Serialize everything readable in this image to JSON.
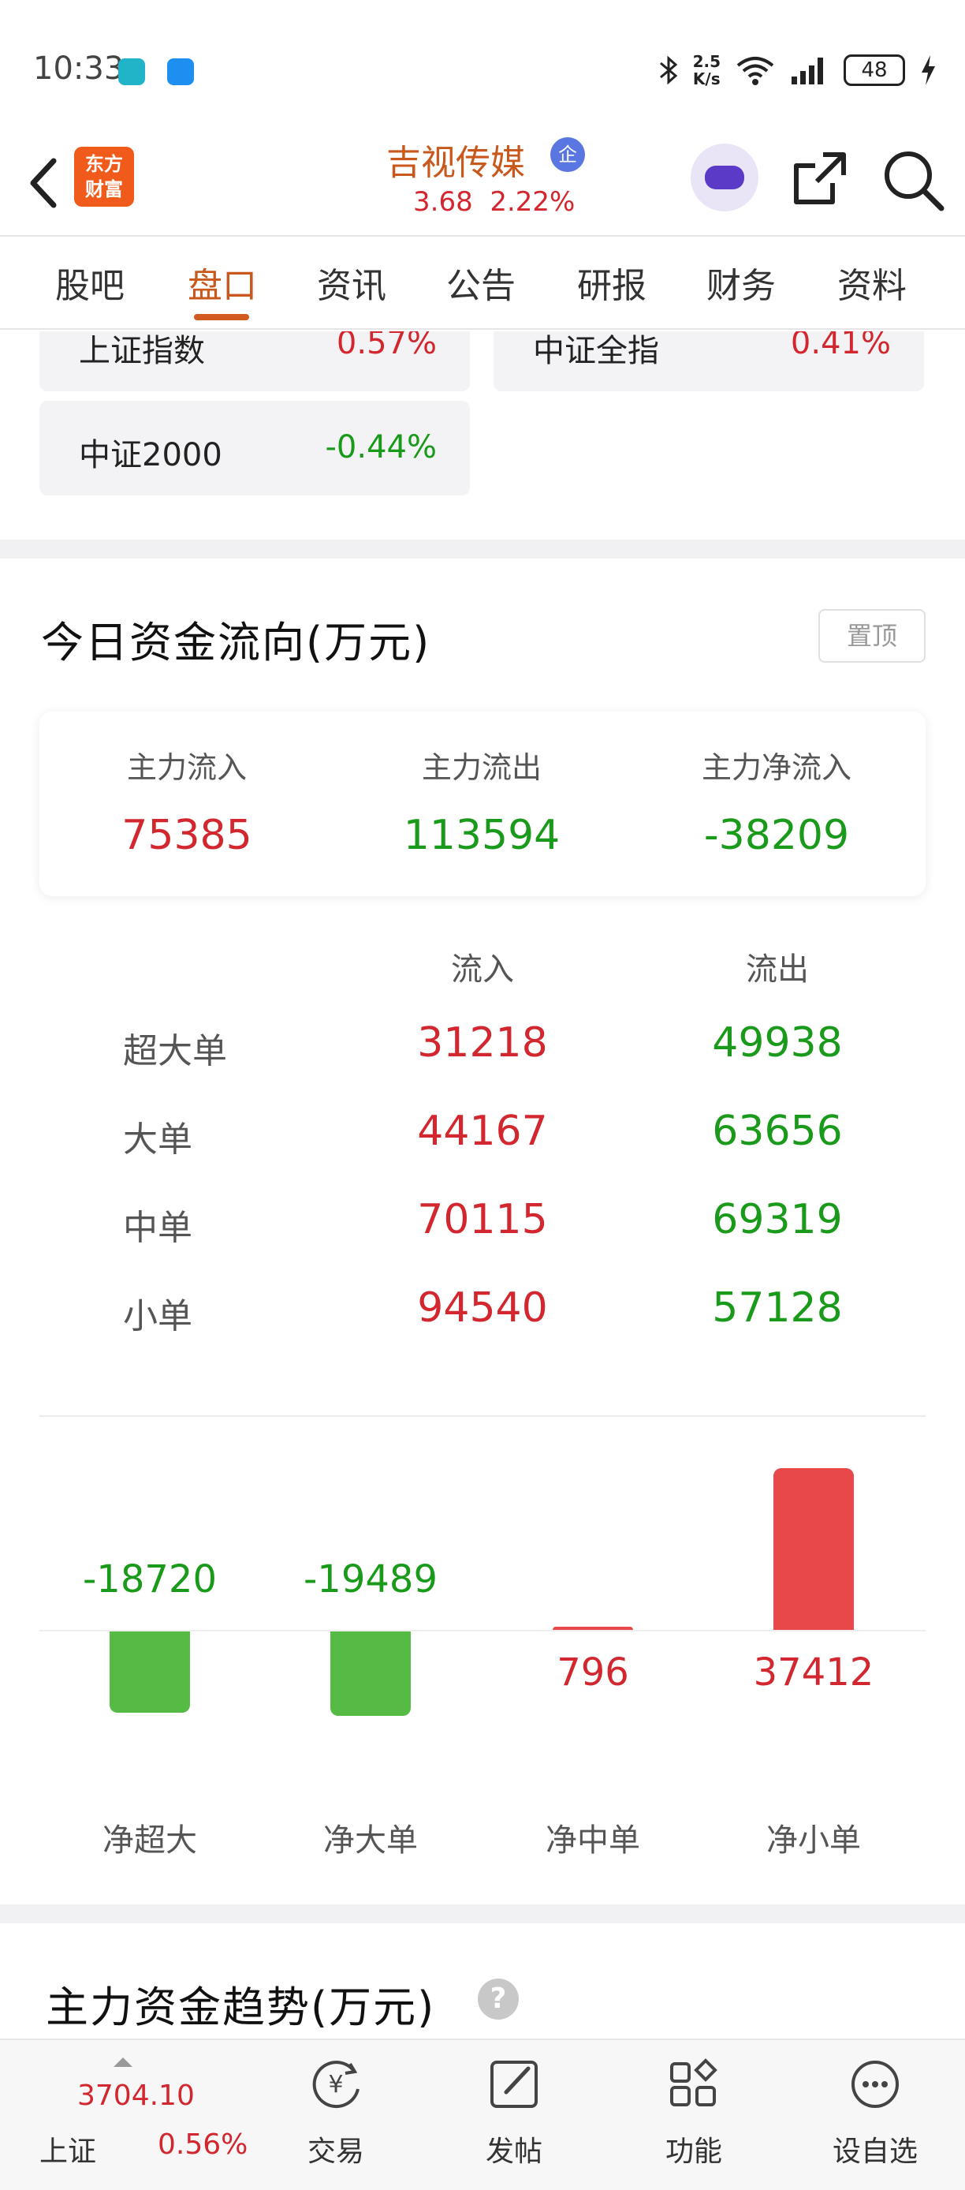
{
  "status_bar": {
    "time": "10:33",
    "net_speed_value": "2.5",
    "net_speed_unit": "K/s",
    "battery": "48"
  },
  "header": {
    "logo_text_line1": "东方",
    "logo_text_line2": "财富",
    "stock_name": "吉视传媒",
    "stock_badge": "企",
    "price": "3.68",
    "change_pct": "2.22%"
  },
  "tabs": [
    "股吧",
    "盘口",
    "资讯",
    "公告",
    "研报",
    "财务",
    "资料"
  ],
  "active_tab": "盘口",
  "index_cards": [
    {
      "name": "上证指数",
      "pct": "0.57%"
    },
    {
      "name": "中证全指",
      "pct": "0.41%"
    },
    {
      "name": "中证2000",
      "pct": "-0.44%"
    }
  ],
  "fund_flow": {
    "title": "今日资金流向(万元)",
    "pin_label": "置顶",
    "summary": {
      "inflow_label": "主力流入",
      "inflow_value": "75385",
      "outflow_label": "主力流出",
      "outflow_value": "113594",
      "net_label": "主力净流入",
      "net_value": "-38209"
    },
    "table": {
      "col_in": "流入",
      "col_out": "流出",
      "rows": [
        {
          "name": "超大单",
          "in": "31218",
          "out": "49938"
        },
        {
          "name": "大单",
          "in": "44167",
          "out": "63656"
        },
        {
          "name": "中单",
          "in": "70115",
          "out": "69319"
        },
        {
          "name": "小单",
          "in": "94540",
          "out": "57128"
        }
      ]
    }
  },
  "chart_data": {
    "type": "bar",
    "categories": [
      "净超大",
      "净大单",
      "净中单",
      "净小单"
    ],
    "values": [
      -18720,
      -19489,
      796,
      37412
    ],
    "value_labels": [
      "-18720",
      "-19489",
      "796",
      "37412"
    ],
    "positive_color": "#e8484a",
    "negative_color": "#55bb44",
    "title": "",
    "xlabel": "",
    "ylabel": ""
  },
  "trend_section": {
    "title": "主力资金趋势(万元)",
    "help_icon_text": "?"
  },
  "bottom_bar": {
    "index_value": "3704.10",
    "index_name": "上证",
    "index_pct": "0.56%",
    "items": [
      {
        "label": "交易",
        "icon": "trade-icon"
      },
      {
        "label": "发帖",
        "icon": "post-icon"
      },
      {
        "label": "功能",
        "icon": "grid-icon"
      },
      {
        "label": "设自选",
        "icon": "more-icon"
      }
    ]
  },
  "colors": {
    "brand_orange": "#c9581c",
    "up_red": "#d2272e",
    "down_green": "#1a9a1a"
  }
}
